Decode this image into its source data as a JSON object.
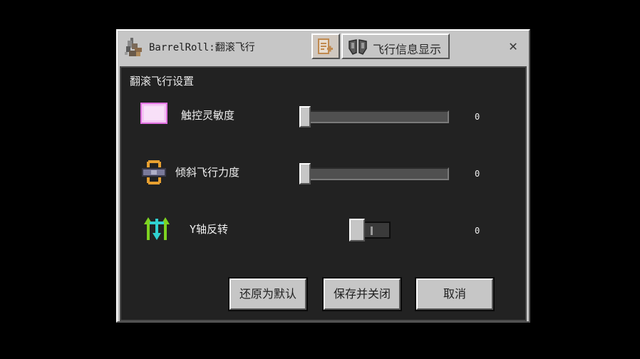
{
  "window": {
    "title": "BarrelRoll:翻滚飞行"
  },
  "toolbar": {
    "info_label": "飞行信息显示",
    "close_glyph": "✕"
  },
  "panel": {
    "title": "翻滚飞行设置"
  },
  "settings": [
    {
      "label": "触控灵敏度",
      "value": "0",
      "slider_fraction": 0
    },
    {
      "label": "倾斜飞行力度",
      "value": "0",
      "slider_fraction": 0
    },
    {
      "label": "Y轴反转",
      "value": "0",
      "toggle_on": false
    }
  ],
  "buttons": {
    "reset": "还原为默认",
    "save_close": "保存并关闭",
    "cancel": "取消"
  },
  "icons": {
    "title": "barrel-roll-elytra-icon",
    "edit": "edit-document-icon",
    "info": "flight-info-icon",
    "row0": "touch-pad-icon",
    "row1": "tilt-arrows-icon",
    "row2": "invert-y-arrows-icon"
  },
  "colors": {
    "window_bg": "#c6c6c6",
    "panel_bg": "#222222",
    "text_light": "#f0f0f0",
    "touch_icon": "#f4c6f4",
    "tilt_icon": "#e8a030",
    "invert_icon_green": "#7ed321",
    "invert_icon_cyan": "#30d0d0"
  }
}
